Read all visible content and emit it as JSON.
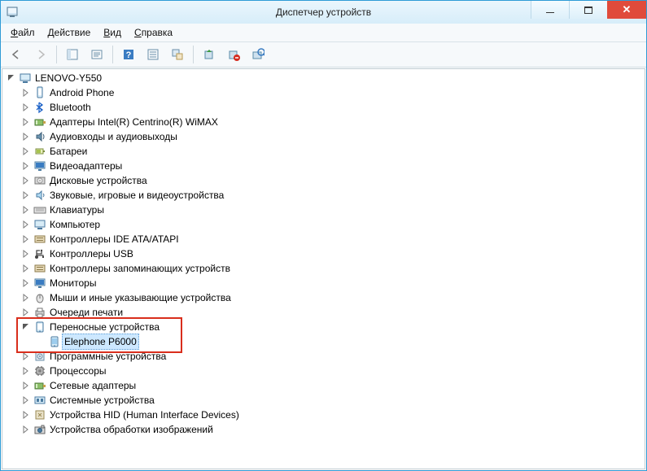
{
  "window": {
    "title": "Диспетчер устройств"
  },
  "menu": {
    "file": {
      "letter": "Ф",
      "rest": "айл"
    },
    "action": {
      "letter": "Д",
      "rest": "ействие"
    },
    "view": {
      "letter": "В",
      "rest": "ид"
    },
    "help": {
      "letter": "С",
      "rest": "правка"
    }
  },
  "tree": {
    "root": "LENOVO-Y550",
    "items": [
      {
        "label": "Android Phone",
        "icon": "phone"
      },
      {
        "label": "Bluetooth",
        "icon": "bt"
      },
      {
        "label": "Адаптеры Intel(R) Centrino(R) WiMAX",
        "icon": "net"
      },
      {
        "label": "Аудиовходы и аудиовыходы",
        "icon": "audio"
      },
      {
        "label": "Батареи",
        "icon": "battery"
      },
      {
        "label": "Видеоадаптеры",
        "icon": "display"
      },
      {
        "label": "Дисковые устройства",
        "icon": "disk"
      },
      {
        "label": "Звуковые, игровые и видеоустройства",
        "icon": "sound"
      },
      {
        "label": "Клавиатуры",
        "icon": "keyboard"
      },
      {
        "label": "Компьютер",
        "icon": "computer"
      },
      {
        "label": "Контроллеры IDE ATA/ATAPI",
        "icon": "ide"
      },
      {
        "label": "Контроллеры USB",
        "icon": "usb"
      },
      {
        "label": "Контроллеры запоминающих устройств",
        "icon": "storage"
      },
      {
        "label": "Мониторы",
        "icon": "monitor"
      },
      {
        "label": "Мыши и иные указывающие устройства",
        "icon": "mouse"
      },
      {
        "label": "Очереди печати",
        "icon": "printq"
      },
      {
        "label": "Переносные устройства",
        "icon": "portable",
        "expanded": true,
        "children": [
          {
            "label": "Elephone P6000",
            "icon": "portabledev",
            "selected": true
          }
        ]
      },
      {
        "label": "Программные устройства",
        "icon": "software"
      },
      {
        "label": "Процессоры",
        "icon": "cpu"
      },
      {
        "label": "Сетевые адаптеры",
        "icon": "netcard"
      },
      {
        "label": "Системные устройства",
        "icon": "system"
      },
      {
        "label": "Устройства HID (Human Interface Devices)",
        "icon": "hid"
      },
      {
        "label": "Устройства обработки изображений",
        "icon": "imaging"
      }
    ]
  }
}
